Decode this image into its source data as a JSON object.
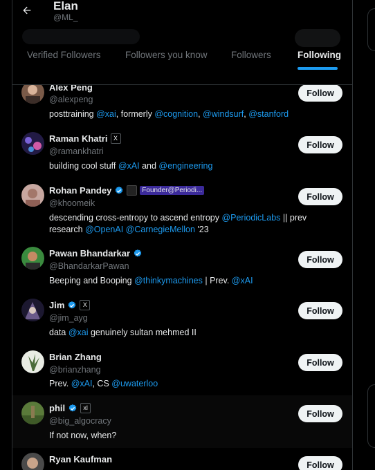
{
  "header": {
    "name": "Elan",
    "handle": "@ML_"
  },
  "tabs": [
    "Verified Followers",
    "Followers you know",
    "Followers",
    "Following"
  ],
  "accent_color": "#1d9bf0",
  "follow_label": "Follow",
  "users": [
    {
      "name": "Alex Peng",
      "handle": "@alexpeng",
      "bio": [
        {
          "t": "posttraining "
        },
        {
          "t": "@xai",
          "m": 1
        },
        {
          "t": ", formerly "
        },
        {
          "t": "@cognition",
          "m": 1
        },
        {
          "t": ", "
        },
        {
          "t": "@windsurf",
          "m": 1
        },
        {
          "t": ", "
        },
        {
          "t": "@stanford",
          "m": 1
        }
      ]
    },
    {
      "name": "Raman Khatri",
      "handle": "@ramankhatri",
      "badge": "X",
      "bio": [
        {
          "t": "building cool stuff "
        },
        {
          "t": "@xAI",
          "m": 1
        },
        {
          "t": " and "
        },
        {
          "t": "@engineering",
          "m": 1
        }
      ]
    },
    {
      "name": "Rohan Pandey",
      "handle": "@khoomeik",
      "verified": true,
      "affiliation": "Founder@Periodi...",
      "bio": [
        {
          "t": "descending cross-entropy to ascend entropy "
        },
        {
          "t": "@PeriodicLabs",
          "m": 1
        },
        {
          "t": " || prev research "
        },
        {
          "t": "@OpenAI",
          "m": 1
        },
        {
          "t": " "
        },
        {
          "t": "@CarnegieMellon",
          "m": 1
        },
        {
          "t": " '23"
        }
      ]
    },
    {
      "name": "Pawan Bhandarkar",
      "handle": "@BhandarkarPawan",
      "verified": true,
      "bio": [
        {
          "t": "Beeping and Booping "
        },
        {
          "t": "@thinkymachines",
          "m": 1
        },
        {
          "t": " | Prev. "
        },
        {
          "t": "@xAI",
          "m": 1
        }
      ]
    },
    {
      "name": "Jim",
      "handle": "@jim_ayg",
      "verified": true,
      "badge": "X",
      "bio": [
        {
          "t": "data "
        },
        {
          "t": "@xai",
          "m": 1
        },
        {
          "t": " genuinely sultan mehmed II"
        }
      ]
    },
    {
      "name": "Brian Zhang",
      "handle": "@brianzhang",
      "bio": [
        {
          "t": "Prev. "
        },
        {
          "t": "@xAI",
          "m": 1
        },
        {
          "t": ", CS "
        },
        {
          "t": "@uwaterloo",
          "m": 1
        }
      ]
    },
    {
      "name": "phil",
      "handle": "@big_algocracy",
      "verified": true,
      "badge": "xl",
      "bio": [
        {
          "t": "If not now, when?"
        }
      ]
    },
    {
      "name": "Ryan Kaufman",
      "handle": "",
      "bio": []
    }
  ]
}
